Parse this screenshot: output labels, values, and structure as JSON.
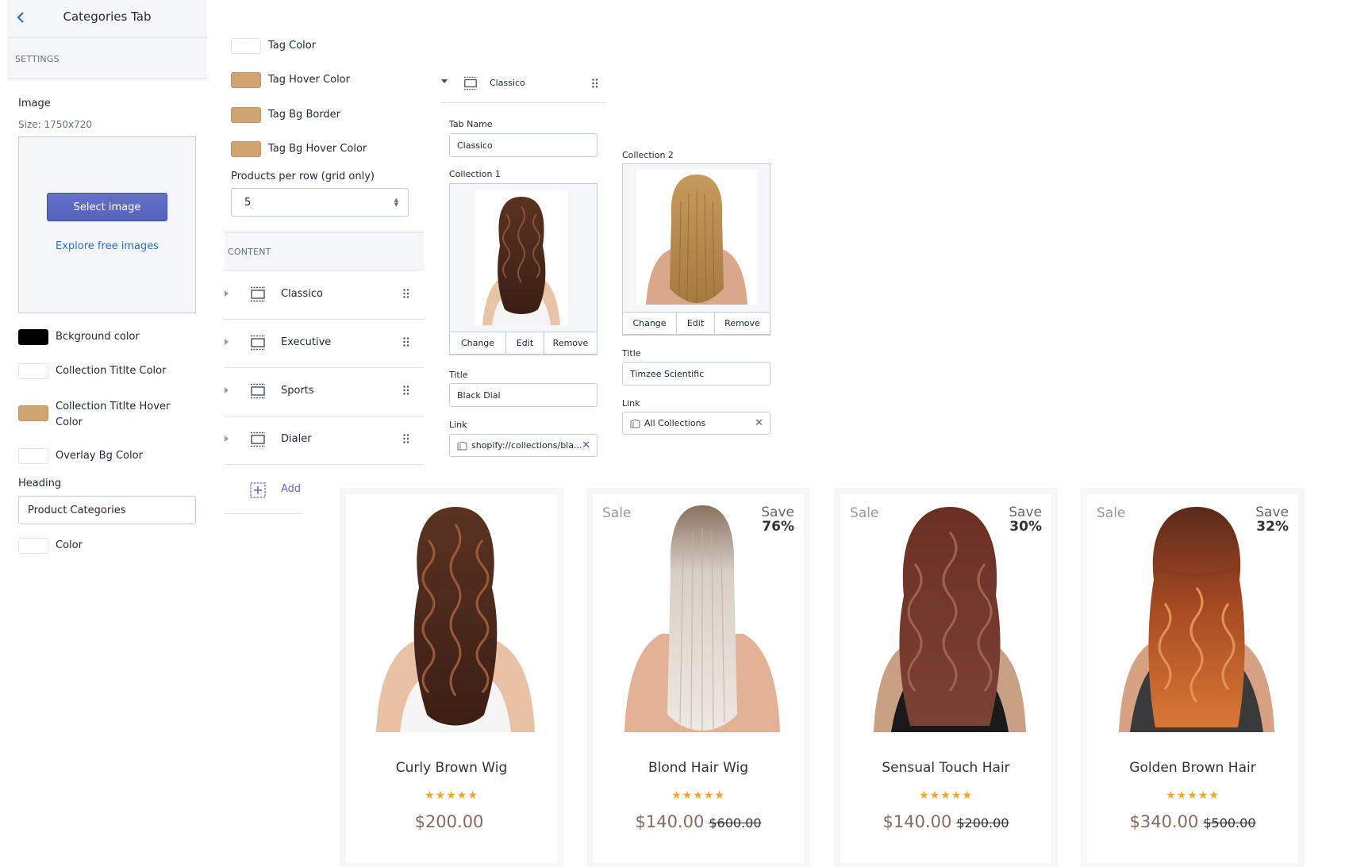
{
  "colors": {
    "accent": "#5c6ac4",
    "link": "#2c6ecb",
    "tan": "#d1a571",
    "price": "#8a6a5c",
    "star": "#f5a623"
  },
  "panel1": {
    "title": "Categories Tab",
    "back_icon": "chevron-left-icon",
    "settings_label": "SETTINGS",
    "image_label": "Image",
    "image_size": "Size: 1750x720",
    "select_image": "Select image",
    "explore_free": "Explore free images",
    "bg_color_label": "Bckground color",
    "collection_title_color": "Collection Titlte Color",
    "collection_title_hover": "Collection Titlte Hover Color",
    "overlay_bg_color": "Overlay Bg Color",
    "heading_label": "Heading",
    "heading_value": "Product Categories",
    "color_label": "Color"
  },
  "panel2": {
    "tag_color": "Tag Color",
    "tag_hover_color": "Tag Hover Color",
    "tag_bg_border": "Tag Bg Border",
    "tag_bg_hover_color": "Tag Bg Hover Color",
    "products_per_row_label": "Products per row (grid only)",
    "products_per_row_value": "5",
    "content_label": "CONTENT",
    "blocks": [
      "Classico",
      "Executive",
      "Sports",
      "Dialer"
    ],
    "add_label": "Add"
  },
  "panel3": {
    "block_name": "Classico",
    "tab_name_label": "Tab Name",
    "tab_name_value": "Classico",
    "collection1_label": "Collection 1",
    "collection2_label": "Collection 2",
    "change": "Change",
    "edit": "Edit",
    "remove": "Remove",
    "title_label": "Title",
    "title1_value": "Black Dial",
    "title2_value": "Timzee Scientific",
    "link_label": "Link",
    "link1_value": "shopify://collections/bla...",
    "link2_value": "All Collections"
  },
  "products": [
    {
      "name": "Curly Brown Wig",
      "price": "$200.00",
      "old_price": "",
      "sale": "",
      "save_word": "",
      "save_pct": "",
      "stars": "★★★★★"
    },
    {
      "name": "Blond Hair Wig",
      "price": "$140.00",
      "old_price": "$600.00",
      "sale": "Sale",
      "save_word": "Save",
      "save_pct": "76%",
      "stars": "★★★★★"
    },
    {
      "name": "Sensual Touch Hair",
      "price": "$140.00",
      "old_price": "$200.00",
      "sale": "Sale",
      "save_word": "Save",
      "save_pct": "30%",
      "stars": "★★★★★"
    },
    {
      "name": "Golden Brown Hair",
      "price": "$340.00",
      "old_price": "$500.00",
      "sale": "Sale",
      "save_word": "Save",
      "save_pct": "32%",
      "stars": "★★★★★"
    }
  ]
}
